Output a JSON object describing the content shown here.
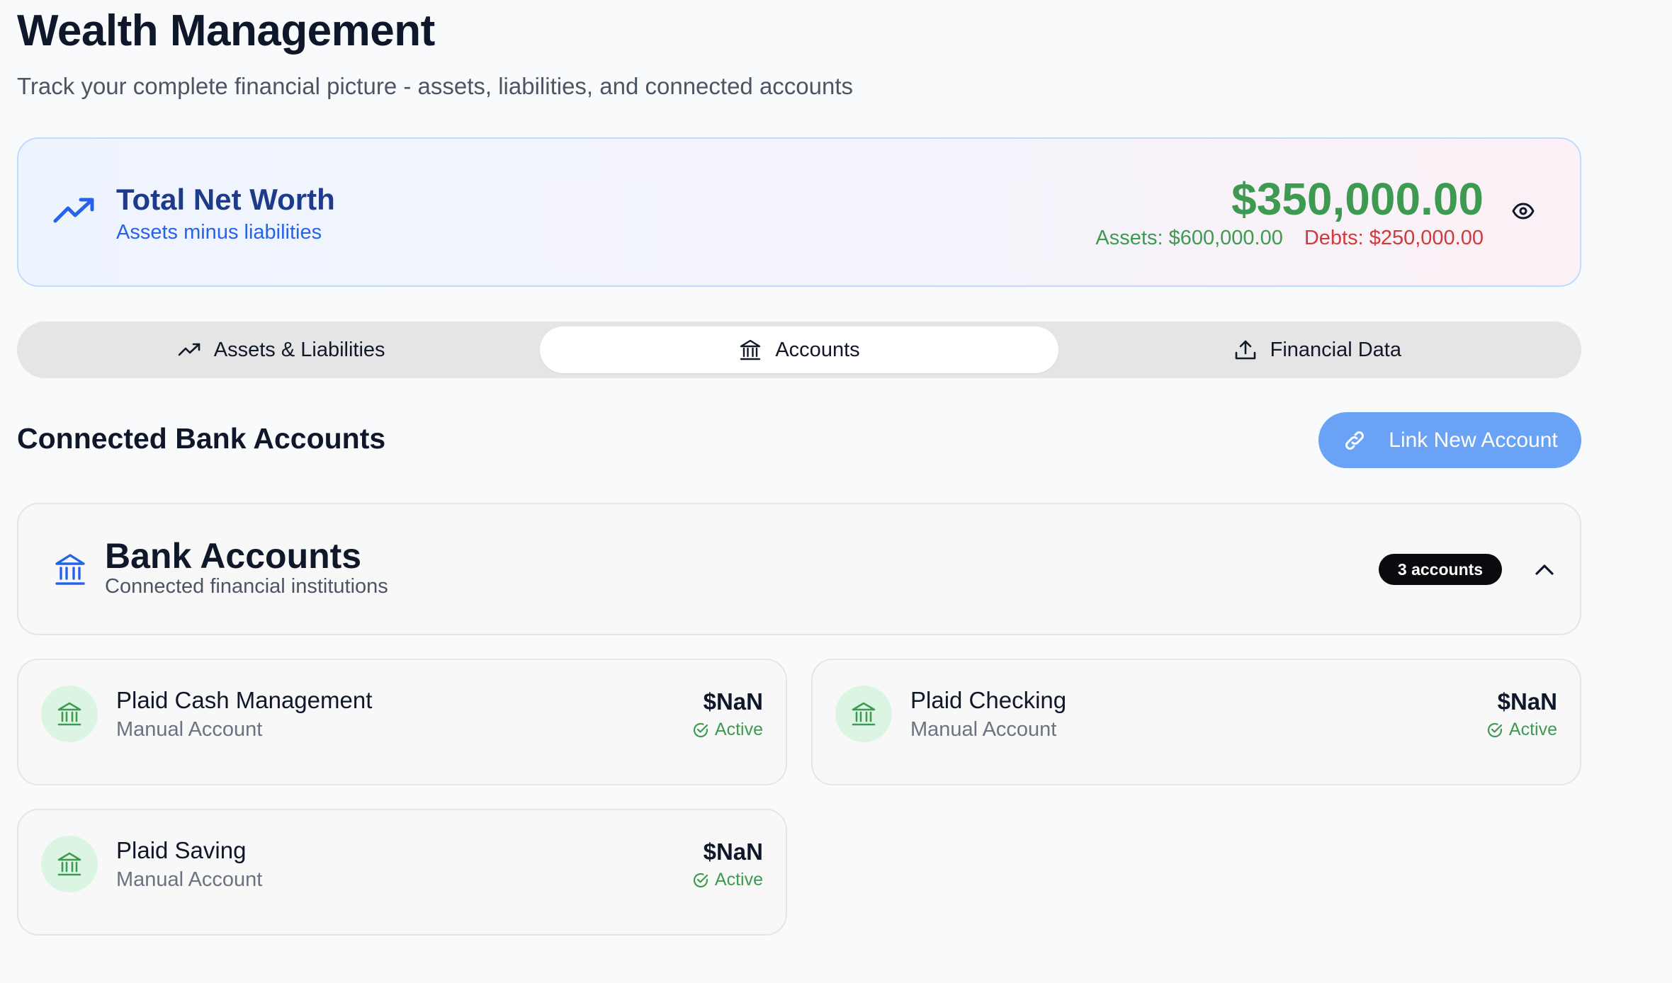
{
  "page": {
    "title": "Wealth Management",
    "subtitle": "Track your complete financial picture - assets, liabilities, and connected accounts"
  },
  "net_worth": {
    "title": "Total Net Worth",
    "subtitle": "Assets minus liabilities",
    "value": "$350,000.00",
    "assets": "Assets: $600,000.00",
    "debts": "Debts: $250,000.00",
    "icon": "trending-up-icon",
    "toggle_icon": "eye-icon"
  },
  "tabs": [
    {
      "label": "Assets & Liabilities",
      "icon": "trending-up-icon",
      "active": false
    },
    {
      "label": "Accounts",
      "icon": "bank-icon",
      "active": true
    },
    {
      "label": "Financial Data",
      "icon": "upload-icon",
      "active": false
    }
  ],
  "section": {
    "title": "Connected Bank Accounts",
    "link_button": "Link New Account"
  },
  "group": {
    "title": "Bank Accounts",
    "subtitle": "Connected financial institutions",
    "badge": "3 accounts"
  },
  "accounts": [
    {
      "name": "Plaid Cash Management",
      "type": "Manual Account",
      "balance": "$NaN",
      "status": "Active"
    },
    {
      "name": "Plaid Checking",
      "type": "Manual Account",
      "balance": "$NaN",
      "status": "Active"
    },
    {
      "name": "Plaid Saving",
      "type": "Manual Account",
      "balance": "$NaN",
      "status": "Active"
    }
  ],
  "colors": {
    "positive": "#3f9a51",
    "negative": "#d13a3a",
    "primary": "#6aa2f6",
    "heading_blue": "#1e3a8a"
  }
}
